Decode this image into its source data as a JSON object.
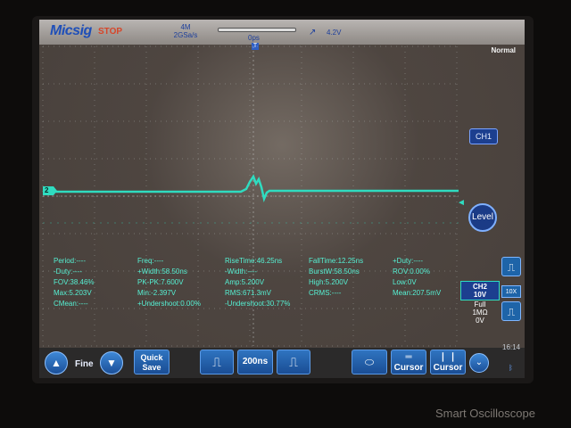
{
  "top": {
    "brand": "Micsig",
    "run_state": "STOP",
    "sample_top": "4M",
    "sample_bottom": "2GSa/s",
    "delay": "0ps",
    "trigger_marker": "T",
    "trigger_slope": "↗",
    "trigger_level": "4.2V"
  },
  "right": {
    "mode": "Normal",
    "ch1_label": "CH1",
    "level_label": "Level",
    "ch2_title": "CH2",
    "ch2_scale": "10V",
    "ch2_bw": "Full",
    "ch2_impedance": "1MΩ",
    "ch2_offset": "0V",
    "probe": "10X",
    "clock": "16:14",
    "bluetooth_icon": "bluetooth-icon"
  },
  "channel_marker": "2",
  "measurements": {
    "period": "Period:----",
    "freq": "Freq:----",
    "rise_time": "RiseTime:46.25ns",
    "fall_time": "FallTime:12.25ns",
    "pos_duty": "+Duty:----",
    "neg_duty": "-Duty:----",
    "pos_width": "+Width:58.50ns",
    "neg_width": "-Width:----",
    "burst_width": "BurstW:58.50ns",
    "rov": "ROV:0.00%",
    "fov": "FOV:38.46%",
    "pk_pk": "PK-PK:7.600V",
    "amp": "Amp:5.200V",
    "high": "High:5.200V",
    "low": "Low:0V",
    "max": "Max:5.203V",
    "min": "Min:-2.397V",
    "rms": "RMS:671.3mV",
    "crms": "CRMS:----",
    "mean": "Mean:207.5mV",
    "cmean": "CMean:----",
    "pos_undershoot": "+Undershoot:0.00%",
    "neg_undershoot": "-Undershoot:30.77%"
  },
  "bottom": {
    "fine_label": "Fine",
    "quick_save_line1": "Quick",
    "quick_save_line2": "Save",
    "timebase": "200ns",
    "cursor1_label": "Cursor",
    "cursor2_label": "Cursor"
  },
  "watermark": "Smart Oscilloscope",
  "colors": {
    "trace": "#2fdcc0",
    "accent": "#1e64a8",
    "run_state": "#d6462a"
  }
}
